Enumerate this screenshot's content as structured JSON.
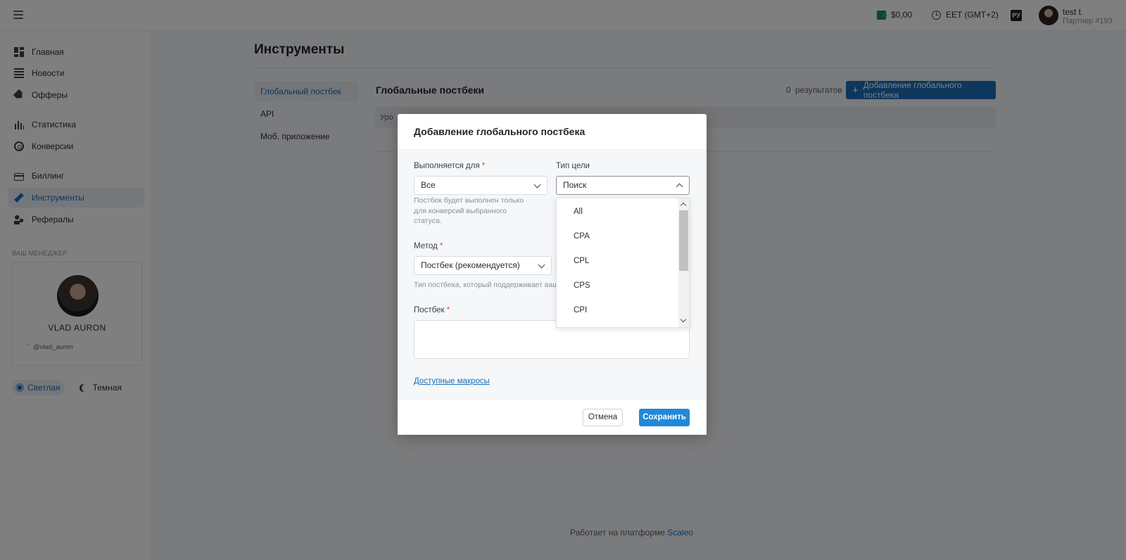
{
  "topbar": {
    "balance": "$0,00",
    "timezone": "EET (GMT+2)",
    "lang": "РУ",
    "user_name": "test t.",
    "user_sub": "Партнер #193"
  },
  "sidebar": {
    "items": [
      {
        "label": "Главная",
        "icon": "dashboard-icon"
      },
      {
        "label": "Новости",
        "icon": "news-icon"
      },
      {
        "label": "Офферы",
        "icon": "tag-icon"
      },
      {
        "label": "Статистика",
        "icon": "bar-chart-icon"
      },
      {
        "label": "Конверсии",
        "icon": "target-icon"
      },
      {
        "label": "Биллинг",
        "icon": "credit-card-icon"
      },
      {
        "label": "Инструменты",
        "icon": "wrench-icon",
        "active": true
      },
      {
        "label": "Рефералы",
        "icon": "referrals-icon"
      }
    ],
    "manager_label": "ВАШ МЕНЕДЖЕР",
    "manager_name": "VLAD AURON",
    "manager_telegram": "@vlad_auron",
    "theme_light": "Светлая",
    "theme_dark": "Темная"
  },
  "main": {
    "title": "Инструменты",
    "subnav": [
      "Глобальный постбек",
      "API",
      "Моб. приложение"
    ],
    "section_title": "Глобальные постбеки",
    "results": "0 результатов",
    "add_button": "Добавление глобального постбека",
    "table_header_first": "Уро",
    "footer_text": "Работает на платформе",
    "footer_link": "Scaleo"
  },
  "modal": {
    "title": "Добавление глобального постбека",
    "executes_for_label": "Выполняется для",
    "executes_for_value": "Все",
    "executes_for_hint": "Постбек будет выполнен только для конверсий выбранного статуса.",
    "goal_type_label": "Тип цели",
    "goal_type_search": "Поиск",
    "goal_type_options": [
      "All",
      "CPA",
      "CPL",
      "CPS",
      "CPI"
    ],
    "method_label": "Метод",
    "method_value": "Постбек (рекомендуется)",
    "method_hint": "Тип постбека, который поддерживает ваша",
    "postback_label": "Постбек",
    "macros_link": "Доступные макросы",
    "cancel": "Отмена",
    "save": "Сохранить"
  },
  "colors": {
    "accent": "#1b6fb8",
    "save_button": "#2189d8",
    "required": "#e5484d"
  }
}
